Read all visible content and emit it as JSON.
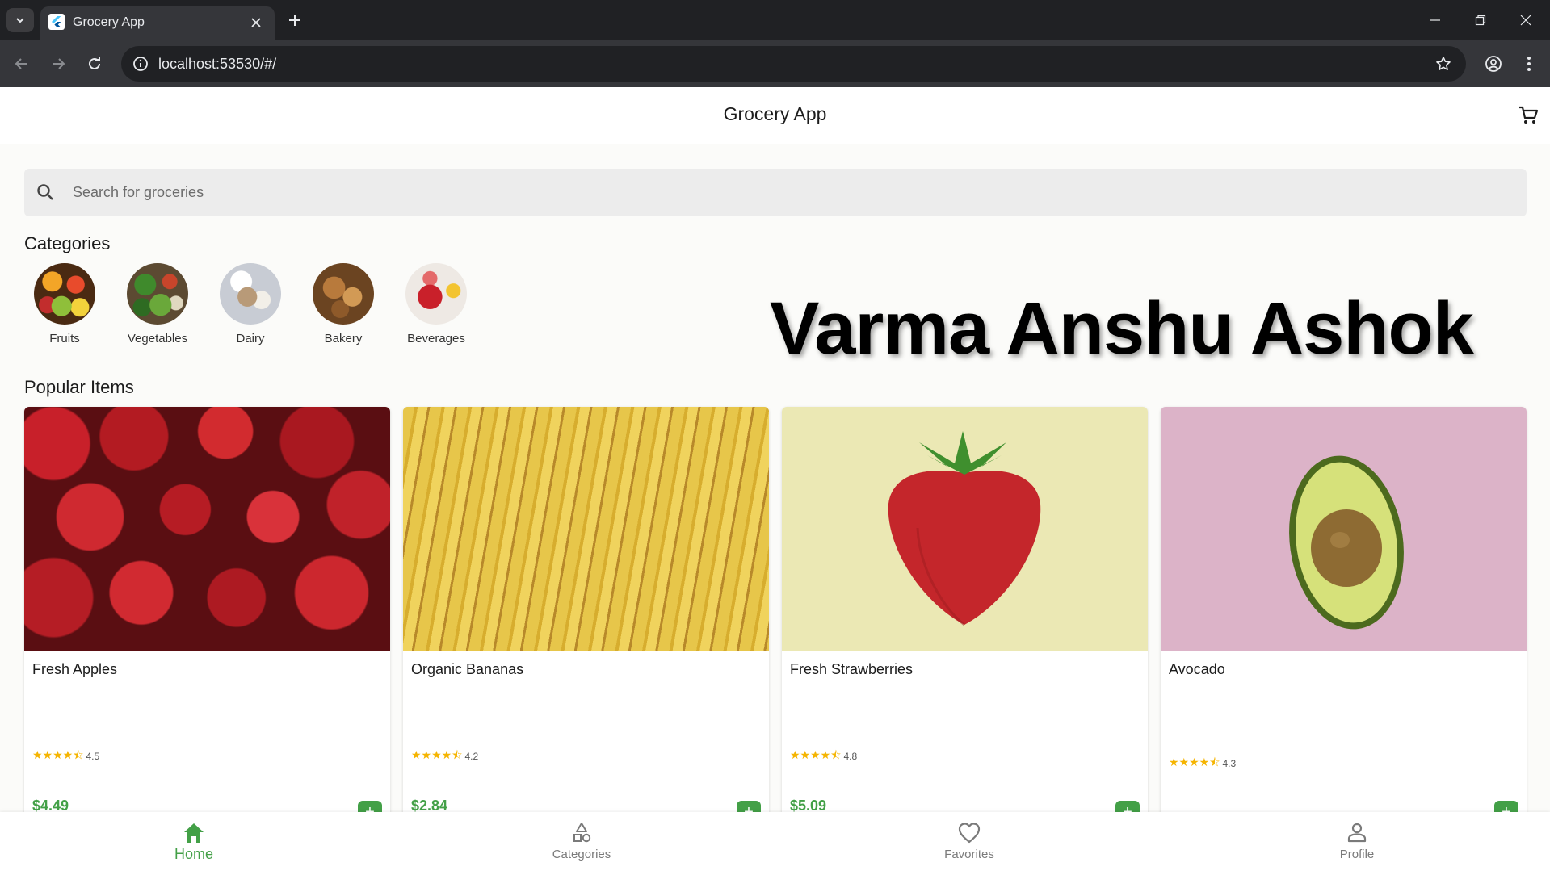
{
  "browser": {
    "tab_title": "Grocery App",
    "url": "localhost:53530/#/"
  },
  "app": {
    "title": "Grocery App",
    "search_placeholder": "Search for groceries",
    "accent_color": "#43a047"
  },
  "categories": {
    "heading": "Categories",
    "items": [
      {
        "label": "Fruits"
      },
      {
        "label": "Vegetables"
      },
      {
        "label": "Dairy"
      },
      {
        "label": "Bakery"
      },
      {
        "label": "Beverages"
      }
    ]
  },
  "watermark": "Varma Anshu Ashok",
  "popular": {
    "heading": "Popular Items",
    "items": [
      {
        "name": "Fresh Apples",
        "rating": "4.5",
        "price": "$4.49"
      },
      {
        "name": "Organic Bananas",
        "rating": "4.2",
        "price": "$2.84"
      },
      {
        "name": "Fresh Strawberries",
        "rating": "4.8",
        "price": "$5.09"
      },
      {
        "name": "Avocado",
        "rating": "4.3",
        "price": ""
      }
    ],
    "stars_glyph": "★★★★⯪",
    "add_label": "+"
  },
  "bottom_nav": {
    "items": [
      {
        "label": "Home",
        "icon": "home-icon",
        "active": true
      },
      {
        "label": "Categories",
        "icon": "categories-icon",
        "active": false
      },
      {
        "label": "Favorites",
        "icon": "heart-icon",
        "active": false
      },
      {
        "label": "Profile",
        "icon": "person-icon",
        "active": false
      }
    ]
  }
}
